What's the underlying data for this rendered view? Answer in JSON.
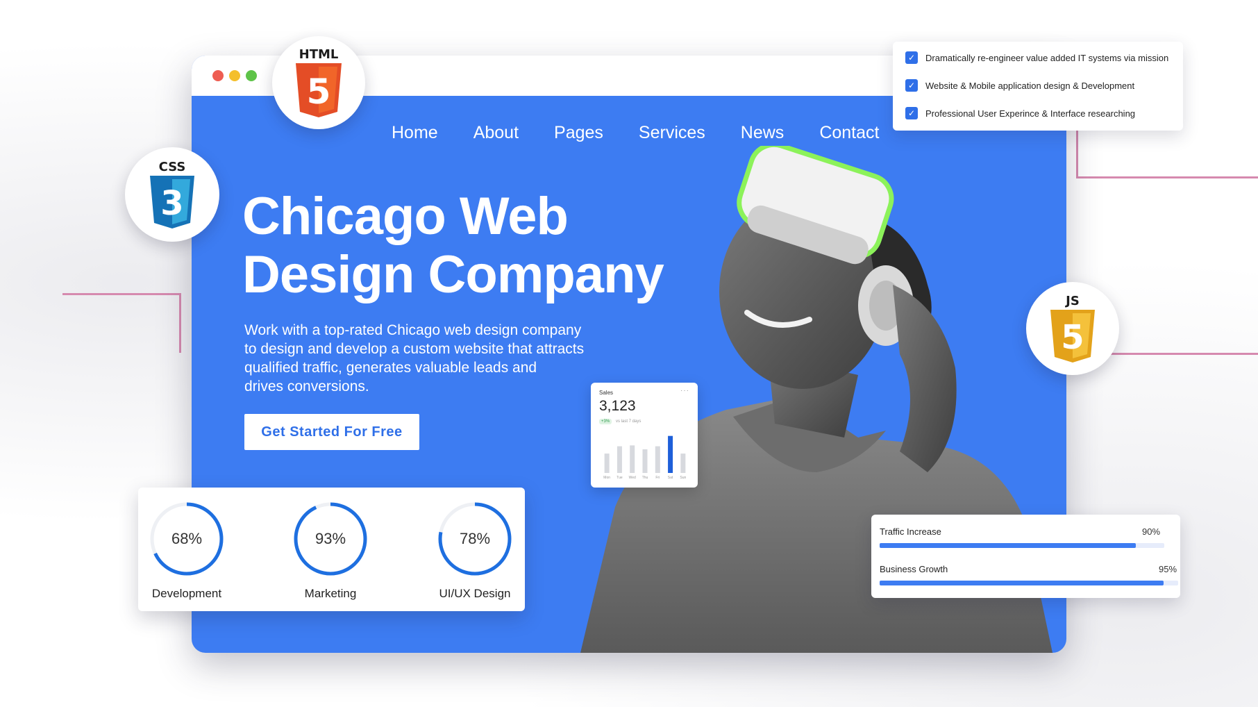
{
  "window": {
    "controls": [
      "close",
      "minimize",
      "maximize"
    ]
  },
  "nav": {
    "items": [
      "Home",
      "About",
      "Pages",
      "Services",
      "News",
      "Contact"
    ]
  },
  "hero": {
    "title_line1": "Chicago Web",
    "title_line2": "Design Company",
    "subtitle_lines": [
      "Work with a top-rated Chicago web design company",
      "to design and develop a custom website that attracts",
      "qualified traffic, generates valuable leads and",
      "drives conversions."
    ],
    "cta_label": "Get Started For Free"
  },
  "sales_widget": {
    "label": "Sales",
    "menu": "···",
    "value": "3,123",
    "badge": "+3%",
    "note": "vs last 7 days",
    "days": [
      "Mon",
      "Tue",
      "Wed",
      "Thu",
      "Fri",
      "Sat",
      "Sun"
    ],
    "bar_values": [
      0.45,
      0.62,
      0.64,
      0.55,
      0.62,
      0.86,
      0.45
    ],
    "highlight_index": 5
  },
  "stats": [
    {
      "label": "Development",
      "value_text": "68%",
      "value": 0.68
    },
    {
      "label": "Marketing",
      "value_text": "93%",
      "value": 0.93
    },
    {
      "label": "UI/UX Design",
      "value_text": "78%",
      "value": 0.78
    }
  ],
  "checklist": [
    "Dramatically re-engineer value added IT systems via mission",
    "Website & Mobile application design & Development",
    "Professional User Experince & Interface researching"
  ],
  "progress": [
    {
      "label": "Traffic Increase",
      "value_text": "90%",
      "value": 0.9
    },
    {
      "label": "Business Growth",
      "value_text": "95%",
      "value": 0.95
    }
  ],
  "badges": {
    "html": "HTML",
    "html_digit": "5",
    "css": "CSS",
    "css_digit": "3",
    "js": "JS",
    "js_digit": "5"
  },
  "colors": {
    "brand_blue": "#3d7cf2",
    "ring_blue": "#1e6fe0",
    "html_orange": "#e44d26",
    "css_blue": "#1572b6",
    "js_yellow": "#f0b52b"
  }
}
